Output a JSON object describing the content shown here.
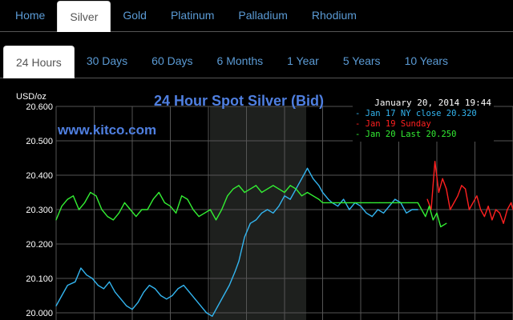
{
  "metal_tabs": {
    "home": "Home",
    "silver": "Silver",
    "gold": "Gold",
    "platinum": "Platinum",
    "palladium": "Palladium",
    "rhodium": "Rhodium"
  },
  "range_tabs": {
    "h24": "24 Hours",
    "d30": "30 Days",
    "d60": "60 Days",
    "m6": "6 Months",
    "y1": "1 Year",
    "y5": "5 Years",
    "y10": "10 Years"
  },
  "colors": {
    "tab_link": "#5b9bd5",
    "title": "#4f7fe0",
    "watermark": "#4f7fe0",
    "ny_close": "#33b5f0",
    "sunday": "#ff2020",
    "last": "#33ee33",
    "grid": "#555555",
    "shade": "#1e201e"
  },
  "chart_data": {
    "type": "line",
    "title": "24 Hour Spot Silver (Bid)",
    "watermark": "www.kitco.com",
    "timestamp": "January 20, 2014 19:44",
    "ylabel": "USD/oz",
    "yticks": [
      "20.600",
      "20.500",
      "20.400",
      "20.300",
      "20.200",
      "20.100",
      "20.000"
    ],
    "ylim": [
      20.0,
      20.6
    ],
    "xlim": [
      0,
      24
    ],
    "grid": true,
    "legend_position": "top-right",
    "legend": [
      {
        "label": "Jan 17 NY close 20.320",
        "color": "#33b5f0"
      },
      {
        "label": "Jan 19 Sunday",
        "color": "#ff2020"
      },
      {
        "label": "Jan 20 Last 20.250",
        "color": "#33ee33"
      }
    ],
    "series": [
      {
        "color": "#33b5f0",
        "x": [
          0,
          0.3,
          0.6,
          1,
          1.3,
          1.6,
          1.9,
          2.2,
          2.5,
          2.8,
          3.1,
          3.4,
          3.7,
          4,
          4.3,
          4.6,
          4.9,
          5.2,
          5.5,
          5.8,
          6.1,
          6.4,
          6.7,
          7,
          7.3,
          7.6,
          7.9,
          8.2,
          8.5,
          8.8,
          9.1,
          9.4,
          9.6,
          9.9,
          10.2,
          10.5,
          10.8,
          11.1,
          11.4,
          11.7,
          12,
          12.3,
          12.6,
          12.9,
          13.2,
          13.5,
          13.8,
          14,
          14.3,
          14.5,
          14.8,
          15.1,
          15.4,
          15.7,
          16,
          16.3,
          16.6,
          16.9,
          17.2,
          17.5,
          17.8,
          18.1,
          18.4,
          18.7,
          19
        ],
        "y": [
          20.02,
          20.05,
          20.08,
          20.09,
          20.13,
          20.11,
          20.1,
          20.08,
          20.07,
          20.09,
          20.06,
          20.04,
          20.02,
          20.01,
          20.03,
          20.06,
          20.08,
          20.07,
          20.05,
          20.04,
          20.05,
          20.07,
          20.08,
          20.06,
          20.04,
          20.02,
          20.0,
          19.99,
          20.02,
          20.05,
          20.08,
          20.12,
          20.15,
          20.22,
          20.26,
          20.27,
          20.29,
          20.3,
          20.29,
          20.31,
          20.34,
          20.33,
          20.36,
          20.39,
          20.42,
          20.39,
          20.37,
          20.35,
          20.33,
          20.32,
          20.31,
          20.33,
          20.3,
          20.32,
          20.31,
          20.29,
          20.28,
          20.3,
          20.29,
          20.31,
          20.33,
          20.32,
          20.29,
          20.3,
          20.3
        ]
      },
      {
        "color": "#ff2020",
        "x": [
          19.5,
          19.7,
          19.9,
          20.1,
          20.3,
          20.5,
          20.7,
          20.9,
          21.1,
          21.3,
          21.5,
          21.7,
          21.9,
          22.1,
          22.3,
          22.5,
          22.7,
          22.9,
          23.1,
          23.3,
          23.5,
          23.7,
          23.9,
          24
        ],
        "y": [
          20.33,
          20.3,
          20.44,
          20.35,
          20.39,
          20.36,
          20.3,
          20.32,
          20.34,
          20.37,
          20.36,
          20.3,
          20.32,
          20.34,
          20.3,
          20.28,
          20.31,
          20.27,
          20.3,
          20.29,
          20.26,
          20.3,
          20.32,
          20.3
        ]
      },
      {
        "color": "#33ee33",
        "x": [
          0,
          0.3,
          0.6,
          0.9,
          1.2,
          1.5,
          1.8,
          2.1,
          2.4,
          2.7,
          3,
          3.3,
          3.6,
          3.9,
          4.2,
          4.5,
          4.8,
          5.1,
          5.4,
          5.7,
          6,
          6.3,
          6.6,
          6.9,
          7.2,
          7.5,
          7.8,
          8.1,
          8.4,
          8.7,
          9,
          9.3,
          9.6,
          9.9,
          10.2,
          10.5,
          10.8,
          11.1,
          11.4,
          11.7,
          12,
          12.3,
          12.6,
          12.9,
          13.2,
          13.5,
          13.8,
          14,
          14.5,
          15,
          15.5,
          16,
          16.5,
          17,
          17.5,
          18,
          18.5,
          19,
          19.2,
          19.4,
          19.6,
          19.8,
          20,
          20.2,
          20.5
        ],
        "y": [
          20.27,
          20.31,
          20.33,
          20.34,
          20.3,
          20.32,
          20.35,
          20.34,
          20.3,
          20.28,
          20.27,
          20.29,
          20.32,
          20.3,
          20.28,
          20.3,
          20.3,
          20.33,
          20.35,
          20.32,
          20.31,
          20.29,
          20.34,
          20.33,
          20.3,
          20.28,
          20.29,
          20.3,
          20.27,
          20.3,
          20.34,
          20.36,
          20.37,
          20.35,
          20.36,
          20.37,
          20.35,
          20.36,
          20.37,
          20.36,
          20.35,
          20.37,
          20.36,
          20.34,
          20.35,
          20.34,
          20.33,
          20.32,
          20.32,
          20.32,
          20.32,
          20.32,
          20.32,
          20.32,
          20.32,
          20.32,
          20.32,
          20.32,
          20.3,
          20.28,
          20.31,
          20.27,
          20.29,
          20.25,
          20.26
        ]
      }
    ]
  }
}
